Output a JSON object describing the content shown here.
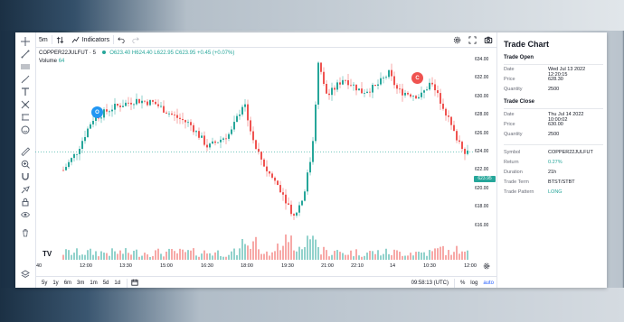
{
  "top_toolbar": {
    "interval": "5m",
    "indicators_label": "Indicators"
  },
  "legend": {
    "symbol_line": "COPPER22JULFUT · 5",
    "ohlc": "O623.40 H624.40 L622.95 C623.95 +0.45 (+0.07%)",
    "volume_label": "Volume",
    "volume_value": "64"
  },
  "markers": {
    "open_label": "O",
    "close_label": "C",
    "open_color": "#2196f3",
    "close_color": "#ef5350"
  },
  "y_axis": {
    "ticks": [
      "634.00",
      "632.00",
      "630.00",
      "628.00",
      "626.00",
      "624.00",
      "622.00",
      "620.00",
      "618.00",
      "616.00"
    ],
    "last_price": "623.95"
  },
  "x_axis": {
    "ticks": [
      "40",
      "12:00",
      "13:30",
      "15:00",
      "16:30",
      "18:00",
      "19:30",
      "21:00",
      "22:10",
      "14",
      "10:30",
      "12:00"
    ]
  },
  "bottom_bar": {
    "ranges": [
      "5y",
      "1y",
      "6m",
      "3m",
      "1m",
      "5d",
      "1d"
    ],
    "time": "09:58:13 (UTC)",
    "percent": "%",
    "log": "log",
    "auto": "auto"
  },
  "trade_panel": {
    "title": "Trade Chart",
    "open": {
      "heading": "Trade Open",
      "date_label": "Date",
      "date_value": "Wed Jul 13 2022 12:20:15",
      "price_label": "Price",
      "price_value": "628.30",
      "qty_label": "Quantity",
      "qty_value": "2500"
    },
    "close": {
      "heading": "Trade Close",
      "date_label": "Date",
      "date_value": "Thu Jul 14 2022 10:00:02",
      "price_label": "Price",
      "price_value": "630.00",
      "qty_label": "Quantity",
      "qty_value": "2500"
    },
    "summary": {
      "symbol_label": "Symbol",
      "symbol_value": "COPPER22JULFUT",
      "return_label": "Return",
      "return_value": "0.27%",
      "duration_label": "Duration",
      "duration_value": "21h",
      "term_label": "Trade Term",
      "term_value": "BTST/STBT",
      "pattern_label": "Trade Pattern",
      "pattern_value": "LONG"
    }
  },
  "colors": {
    "up": "#26a69a",
    "down": "#ef5350",
    "accent": "#2962ff"
  }
}
